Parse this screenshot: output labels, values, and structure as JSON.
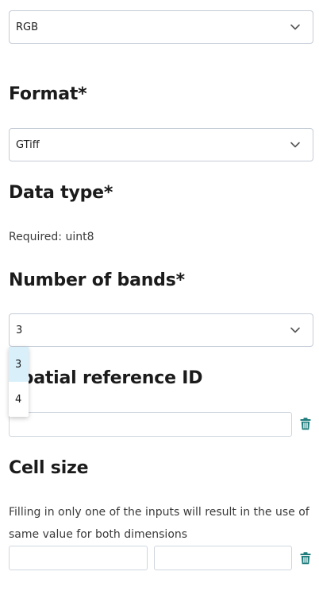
{
  "color_select": {
    "value": "RGB"
  },
  "format": {
    "heading": "Format*",
    "value": "GTiff"
  },
  "data_type": {
    "heading": "Data type*",
    "note": "Required: uint8"
  },
  "bands": {
    "heading": "Number of bands*",
    "value": "3",
    "options": [
      "3",
      "4"
    ]
  },
  "srid": {
    "heading": "Spatial reference ID",
    "value": ""
  },
  "cell_size": {
    "heading": "Cell size",
    "note_line1": "Filling in only one of the inputs will result in the use of",
    "note_line2": "same value for both dimensions",
    "x_value": "",
    "y_value": ""
  },
  "colors": {
    "border": "#c4cbd6",
    "trash": "#1e7c7c",
    "highlight": "#d9f0fb"
  }
}
